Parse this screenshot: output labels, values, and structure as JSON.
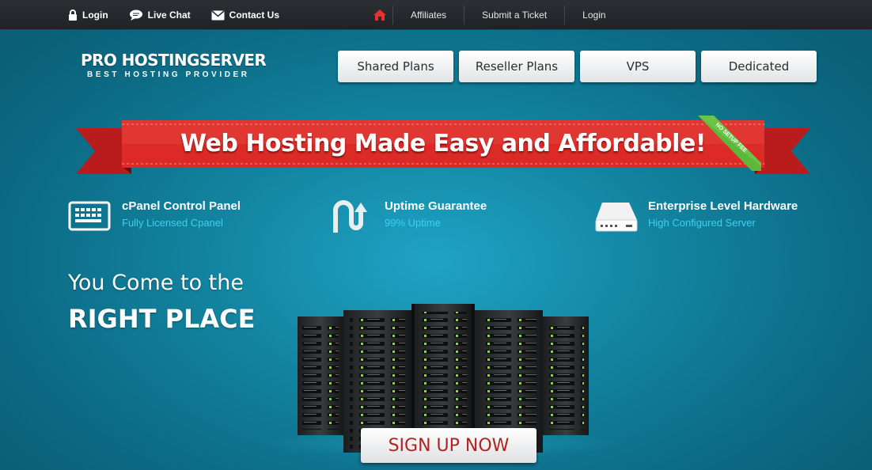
{
  "topbar": {
    "left_links": [
      {
        "label": "Login",
        "icon": "lock-icon"
      },
      {
        "label": "Live Chat",
        "icon": "chat-icon"
      },
      {
        "label": "Contact Us",
        "icon": "envelope-icon"
      }
    ],
    "home_icon": "home-icon",
    "nav_links": [
      "Affiliates",
      "Submit a Ticket",
      "Login"
    ]
  },
  "logo": {
    "title": "PRO HOSTINGSERVER",
    "tagline": "BEST HOSTING PROVIDER"
  },
  "plans": [
    "Shared Plans",
    "Reseller Plans",
    "VPS",
    "Dedicated"
  ],
  "banner": {
    "headline": "Web Hosting Made Easy and Affordable!",
    "corner_tag": "NO SETUP FEE"
  },
  "features": [
    {
      "title": "cPanel Control Panel",
      "subtitle": "Fully Licensed Cpanel",
      "icon": "keyboard-icon"
    },
    {
      "title": "Uptime Guarantee",
      "subtitle": "99% Uptime",
      "icon": "uptime-arrow-icon"
    },
    {
      "title": "Enterprise Level Hardware",
      "subtitle": "High Configured Server",
      "icon": "hard-drive-icon"
    }
  ],
  "hero": {
    "line1": "You Come to the",
    "line2": "RIGHT PLACE",
    "cta": "SIGN UP NOW"
  },
  "colors": {
    "accent_red": "#d82626",
    "accent_cyan": "#3ed0ef",
    "background": "#12839f",
    "topbar": "#25292d",
    "tag_green": "#5cb73a"
  }
}
